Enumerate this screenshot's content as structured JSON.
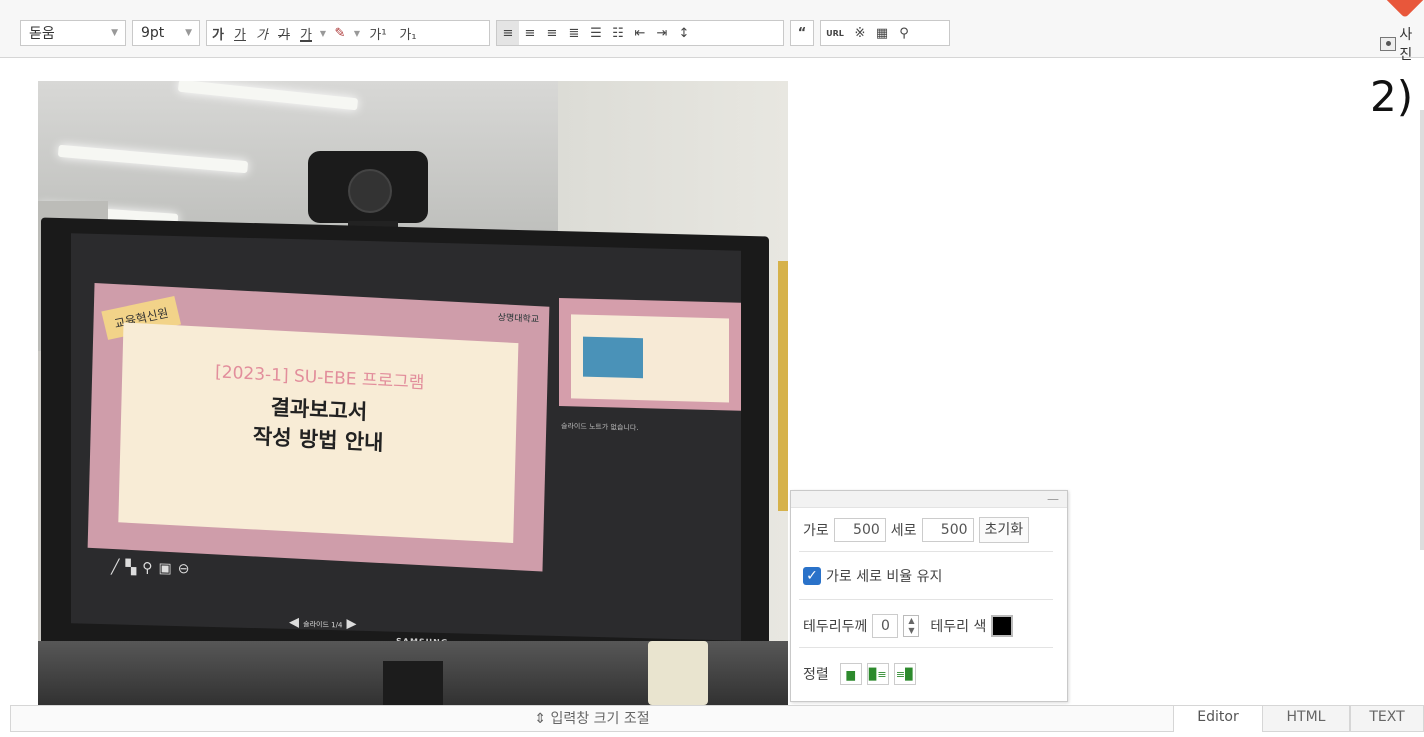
{
  "toolbar": {
    "font_family": "돋움",
    "font_size": "9pt",
    "buttons": [
      {
        "name": "bold",
        "label": "가"
      },
      {
        "name": "italic",
        "label": "가"
      },
      {
        "name": "italic-alt",
        "label": "가"
      },
      {
        "name": "strike",
        "label": "가"
      },
      {
        "name": "underline",
        "label": "가"
      },
      {
        "name": "superscript",
        "label": "가¹"
      },
      {
        "name": "subscript",
        "label": "가₁"
      }
    ],
    "photo_label": "사진"
  },
  "step_label": "2)",
  "slide": {
    "tag": "교육혁신원",
    "logo": "상명대학교",
    "subtitle": "[2023-1] SU-EBE 프로그램",
    "title": "결과보고서\n작성 방법 안내",
    "notes": "슬라이드 노트가 없습니다.",
    "nav": "슬라이드 1/4",
    "monitor_brand": "SAMSUNG"
  },
  "image_panel": {
    "width_label": "가로",
    "width_value": "500",
    "height_label": "세로",
    "height_value": "500",
    "reset_label": "초기화",
    "keep_ratio_label": "가로 세로 비율 유지",
    "keep_ratio_checked": true,
    "border_width_label": "테두리두께",
    "border_width_value": "0",
    "border_color_label": "테두리 색",
    "border_color": "#000000",
    "align_label": "정렬"
  },
  "footer": {
    "resize_label": "⇕ 입력창 크기 조절",
    "tabs": [
      {
        "label": "Editor",
        "active": true
      },
      {
        "label": "HTML",
        "active": false
      },
      {
        "label": "TEXT",
        "active": false
      }
    ]
  },
  "colors": {
    "accent_badge": "#e8573b",
    "checkbox": "#2a72c9"
  }
}
